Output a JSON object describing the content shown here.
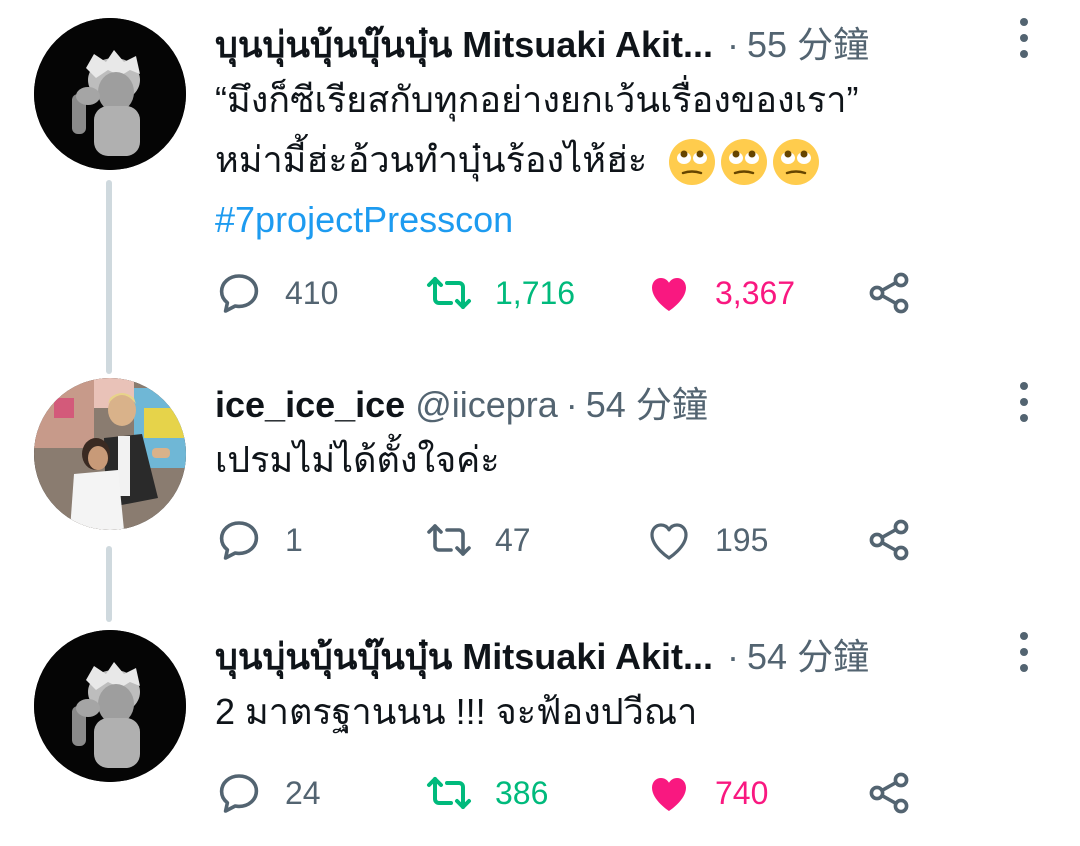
{
  "colors": {
    "retweet_active": "#00ba7c",
    "like_active": "#f91880",
    "hashtag": "#1d9bf0",
    "muted": "#536471",
    "thread_line": "#cfd9de"
  },
  "tweets": [
    {
      "display_name": "บุนบุ่นบุ้นบุ๊นบุ๋น Mitsuaki Akit...",
      "handle": "",
      "dot": "·",
      "time": "55 分鐘",
      "text_line1": "“มึงก็ซีเรียสกับทุกอย่างยกเว้นเรื่องของเรา”",
      "text_line2": "หม่ามี้ฮ่ะอ้วนทำบุ๋นร้องไห้ฮ่ะ",
      "emoji": [
        "face-with-rolling-eyes",
        "face-with-rolling-eyes",
        "face-with-rolling-eyes"
      ],
      "hashtag": "#7projectPresscon",
      "replies": "410",
      "retweets": "1,716",
      "likes": "3,367",
      "retweeted": true,
      "liked": true
    },
    {
      "display_name": "ice_ice_ice",
      "handle": "@iicepra",
      "dot": "·",
      "time": "54 分鐘",
      "text_line1": "เปรมไม่ได้ตั้งใจค่ะ",
      "replies": "1",
      "retweets": "47",
      "likes": "195",
      "retweeted": false,
      "liked": false
    },
    {
      "display_name": "บุนบุ่นบุ้นบุ๊นบุ๋น Mitsuaki Akit...",
      "handle": "",
      "dot": "·",
      "time": "54 分鐘",
      "text_line1": "2 มาตรฐานนน !!! จะฟ้องปวีณา",
      "replies": "24",
      "retweets": "386",
      "likes": "740",
      "retweeted": true,
      "liked": true
    }
  ],
  "icons": {
    "reply": "reply-bubble-icon",
    "retweet": "retweet-icon",
    "like": "heart-icon",
    "share": "share-icon",
    "more": "more-vertical-icon"
  }
}
